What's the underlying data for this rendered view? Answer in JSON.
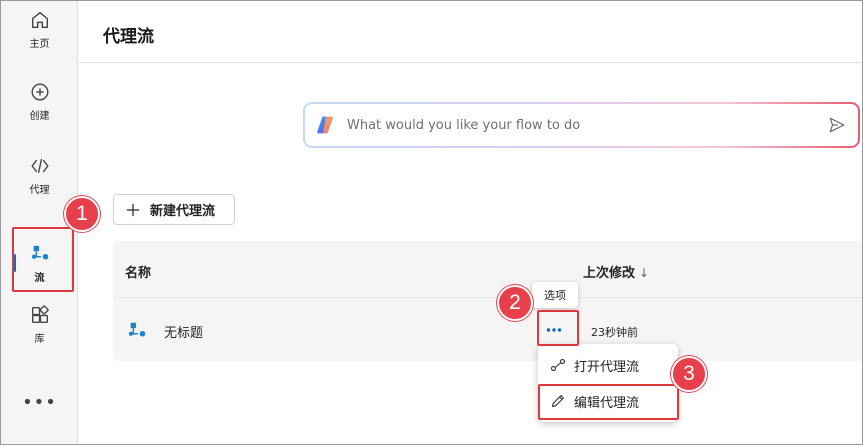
{
  "nav": {
    "items": [
      {
        "label": "主页",
        "icon": "home-icon"
      },
      {
        "label": "创建",
        "icon": "add-circle-icon"
      },
      {
        "label": "代理",
        "icon": "code-icon"
      },
      {
        "label": "流",
        "icon": "flow-icon"
      },
      {
        "label": "库",
        "icon": "apps-add-icon"
      }
    ],
    "active": "流",
    "more_label": "•••"
  },
  "header": {
    "title": "代理流"
  },
  "copilot": {
    "placeholder": "What would you like your flow to do"
  },
  "toolbar": {
    "new_label": "新建代理流"
  },
  "table": {
    "columns": [
      "名称",
      "上次修改"
    ],
    "sort_icon": "↓",
    "rows": [
      {
        "name": "无标题",
        "modified": "23秒钟前",
        "more_label": "•••"
      }
    ]
  },
  "tooltip": {
    "text": "选项"
  },
  "menu": {
    "items": [
      {
        "label": "打开代理流",
        "icon": "open-flow-icon"
      },
      {
        "label": "编辑代理流",
        "icon": "pencil-icon"
      }
    ]
  },
  "annotations": [
    "1",
    "2",
    "3"
  ],
  "colors": {
    "accent": "#0f6cbd",
    "highlight": "#e0373d",
    "badge": "#e8404a",
    "flow_icon": "#1a84c6"
  }
}
